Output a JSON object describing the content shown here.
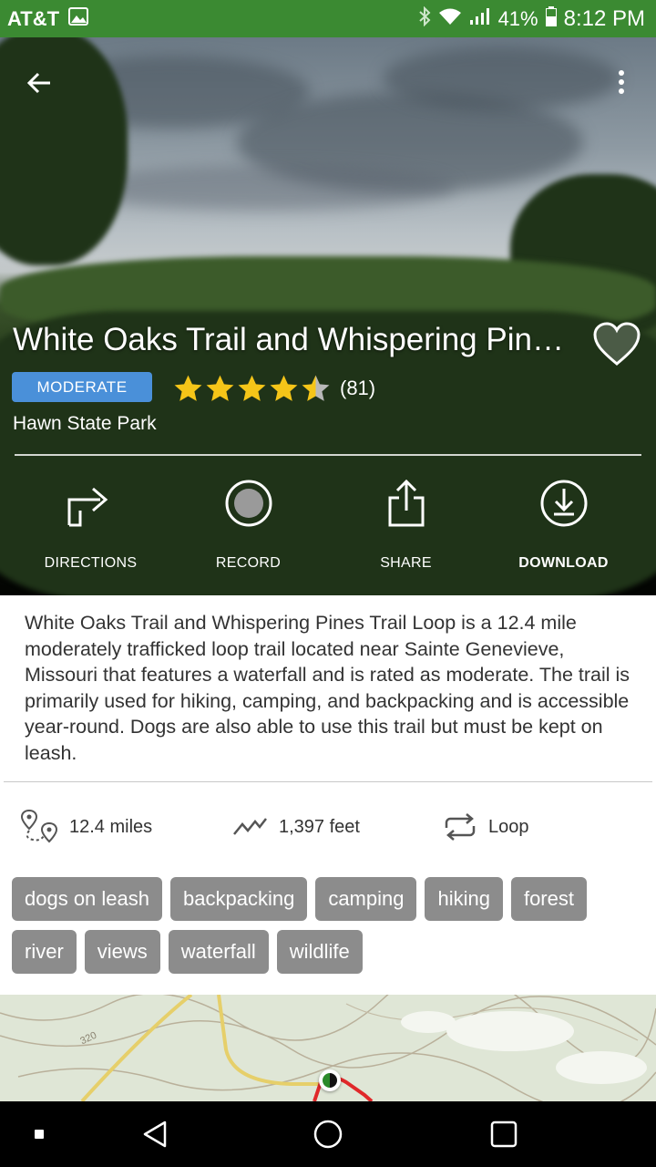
{
  "status_bar": {
    "carrier": "AT&T",
    "battery": "41%",
    "time": "8:12 PM"
  },
  "trail": {
    "title": "White Oaks Trail and Whispering Pin…",
    "difficulty": "MODERATE",
    "rating_value": 4.5,
    "rating_count": "(81)",
    "park": "Hawn State Park"
  },
  "actions": {
    "directions": "DIRECTIONS",
    "record": "RECORD",
    "share": "SHARE",
    "download": "DOWNLOAD"
  },
  "description": "White Oaks Trail and Whispering Pines Trail Loop is a 12.4 mile moderately trafficked loop trail located near Sainte Genevieve, Missouri that features a waterfall and is rated as moderate. The trail is primarily used for hiking, camping, and backpacking and is accessible year-round. Dogs are also able to use this trail but must be kept on leash.",
  "stats": {
    "distance": "12.4 miles",
    "elevation": "1,397 feet",
    "route_type": "Loop"
  },
  "tags": [
    "dogs on leash",
    "backpacking",
    "camping",
    "hiking",
    "forest",
    "river",
    "views",
    "waterfall",
    "wildlife"
  ],
  "map": {
    "road_label": "320"
  },
  "colors": {
    "status_bar": "#3b8a32",
    "difficulty_badge": "#4a90d9",
    "star": "#f5c518",
    "tag": "#8c8c8c",
    "trail_line": "#e0282a"
  }
}
